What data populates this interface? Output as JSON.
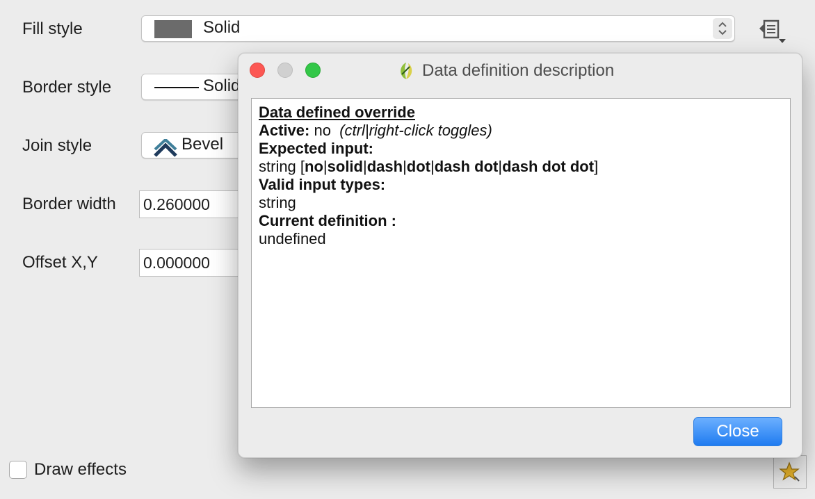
{
  "form": {
    "fill_style_label": "Fill style",
    "fill_style_value": "Solid",
    "border_style_label": "Border style",
    "border_style_value": "Solid",
    "join_style_label": "Join style",
    "join_style_value": "Bevel",
    "border_width_label": "Border width",
    "border_width_value": "0.260000",
    "offset_label": "Offset X,Y",
    "offset_value": "0.000000",
    "draw_effects_label": "Draw effects"
  },
  "dialog": {
    "title": "Data definition description",
    "heading": "Data defined override",
    "active_label": "Active:",
    "active_value": "no",
    "active_hint": "(ctrl|right-click toggles)",
    "expected_input_label": "Expected input:",
    "string_prefix": "string [",
    "options": [
      "no",
      "solid",
      "dash",
      "dot",
      "dash dot",
      "dash dot dot"
    ],
    "separator": "|",
    "string_suffix": "]",
    "valid_types_label": "Valid input types:",
    "valid_types_value": "string",
    "current_def_label": "Current definition :",
    "current_def_value": "undefined",
    "close_label": "Close"
  },
  "colors": {
    "fill_swatch": "#6b6b6b",
    "close_button": "#1f7bf0",
    "traffic_close": "#fc5753",
    "traffic_min": "#d0d0d0",
    "traffic_max": "#33c748"
  },
  "icons": {
    "data_defined": "data-defined-override-icon",
    "title_icon": "qgis-icon",
    "join_icon": "bevel-join-icon",
    "star": "star-favorite-icon"
  }
}
